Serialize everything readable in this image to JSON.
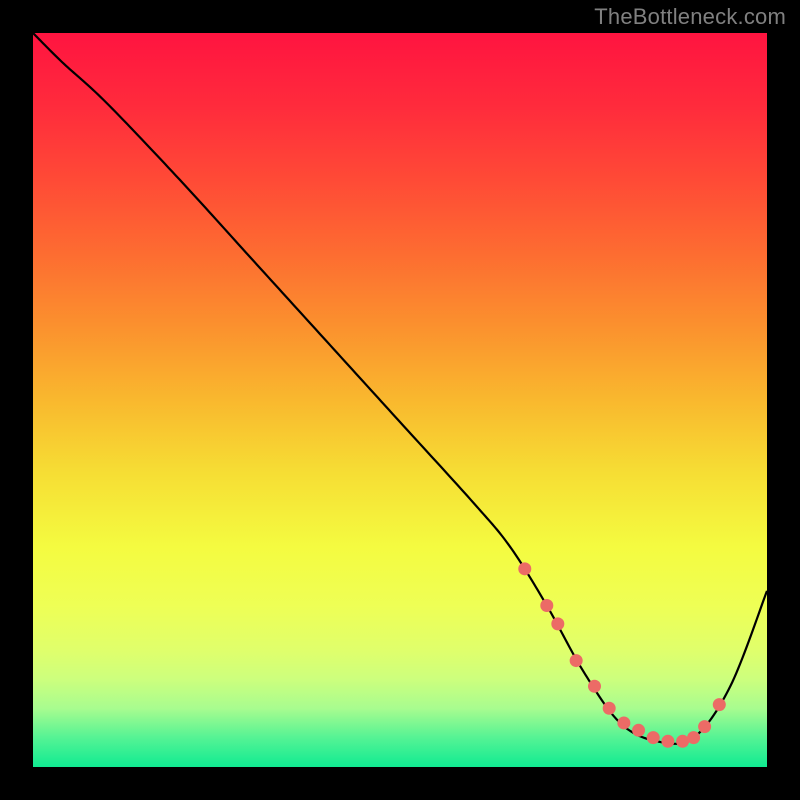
{
  "attribution": "TheBottleneck.com",
  "colors": {
    "background": "#000000",
    "attribution_text": "#808080",
    "curve": "#000000",
    "marker_fill": "#ec6b66",
    "marker_stroke": "#ec6b66"
  },
  "chart_data": {
    "type": "line",
    "title": "",
    "xlabel": "",
    "ylabel": "",
    "xlim": [
      0,
      100
    ],
    "ylim": [
      0,
      100
    ],
    "grid": false,
    "legend": false,
    "background_gradient": {
      "stops": [
        {
          "offset": 0.0,
          "color": "#ff1440"
        },
        {
          "offset": 0.1,
          "color": "#ff2b3c"
        },
        {
          "offset": 0.2,
          "color": "#ff4a36"
        },
        {
          "offset": 0.3,
          "color": "#fd6c31"
        },
        {
          "offset": 0.4,
          "color": "#fb912e"
        },
        {
          "offset": 0.5,
          "color": "#f9b82e"
        },
        {
          "offset": 0.6,
          "color": "#f6de34"
        },
        {
          "offset": 0.7,
          "color": "#f4fb40"
        },
        {
          "offset": 0.78,
          "color": "#eeff55"
        },
        {
          "offset": 0.84,
          "color": "#e0ff6b"
        },
        {
          "offset": 0.88,
          "color": "#cdff7d"
        },
        {
          "offset": 0.92,
          "color": "#a8fc8f"
        },
        {
          "offset": 0.96,
          "color": "#55f394"
        },
        {
          "offset": 1.0,
          "color": "#10eb92"
        }
      ]
    },
    "series": [
      {
        "name": "bottleneck-curve",
        "x": [
          0,
          4,
          10,
          20,
          30,
          40,
          50,
          60,
          65,
          70,
          75,
          80,
          85,
          90,
          95,
          100
        ],
        "y": [
          100,
          96,
          90.5,
          80,
          69,
          58,
          47,
          36,
          30,
          22,
          13,
          6,
          3.5,
          4,
          11,
          24
        ]
      }
    ],
    "markers": {
      "x": [
        67,
        70,
        71.5,
        74,
        76.5,
        78.5,
        80.5,
        82.5,
        84.5,
        86.5,
        88.5,
        90,
        91.5,
        93.5
      ],
      "y": [
        27,
        22,
        19.5,
        14.5,
        11,
        8,
        6,
        5,
        4,
        3.5,
        3.5,
        4,
        5.5,
        8.5
      ]
    }
  }
}
